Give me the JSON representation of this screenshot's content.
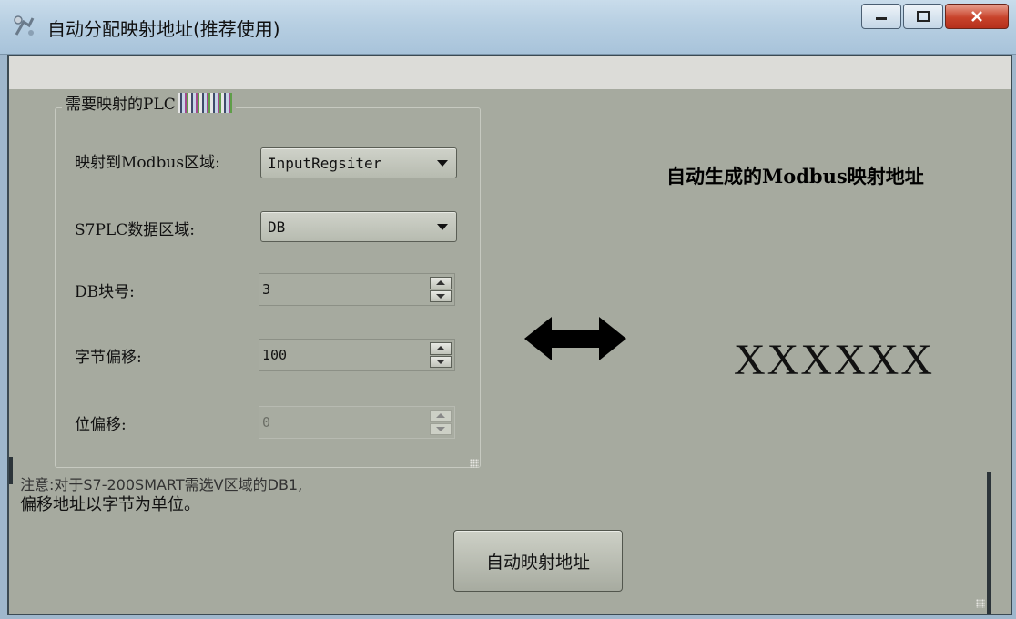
{
  "window": {
    "title": "自动分配映射地址(推荐使用)",
    "controls": [
      "minimize",
      "maximize",
      "close"
    ]
  },
  "group": {
    "title": "需要映射的PLC"
  },
  "fields": {
    "modbus_area": {
      "label": "映射到Modbus区域:",
      "value": "InputRegsiter"
    },
    "s7_area": {
      "label": "S7PLC数据区域:",
      "value": "DB"
    },
    "db_number": {
      "label": "DB块号:",
      "value": "3"
    },
    "byte_offset": {
      "label": "字节偏移:",
      "value": "100"
    },
    "bit_offset": {
      "label": "位偏移:",
      "value": "0"
    }
  },
  "result": {
    "title": "自动生成的Modbus映射地址",
    "value": "XXXXXX"
  },
  "note": {
    "line1": "注意:对于S7-200SMART需选V区域的DB1,",
    "line2": "偏移地址以字节为单位。"
  },
  "actions": {
    "auto_map_label": "自动映射地址"
  },
  "icons": {
    "app": "app-icon",
    "mapping": "double-arrow-icon"
  },
  "colors": {
    "background": "#a6aa9f",
    "titlebar": "#b7cfe2",
    "close_button": "#c8432b"
  }
}
